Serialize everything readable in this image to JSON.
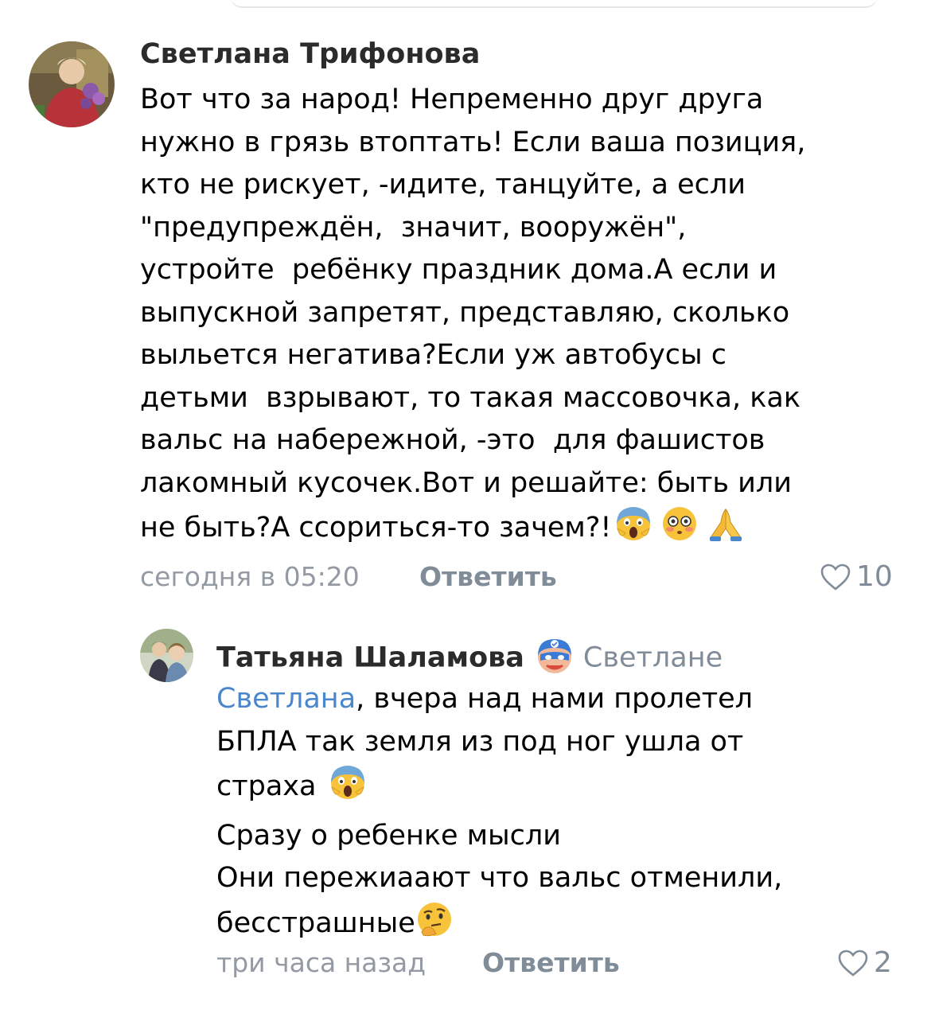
{
  "comments": [
    {
      "author": "Светлана Трифонова",
      "text_lines": [
        "Вот что за народ! Непременно друг друга",
        "нужно в грязь втоптать! Если ваша позиция,",
        "кто не рискует, -идите, танцуйте, а если",
        "\"предупреждён,  значит, вооружён\",",
        "устройте  ребёнку праздник дома.А если и",
        "выпускной запретят, представляю, сколько",
        "выльется негатива?Если уж автобусы с",
        "детьми  взрывают, то такая массовочка, как",
        "вальс на набережной, -это  для фашистов",
        "лакомный кусочек.Вот и решайте: быть или",
        "не быть?А ссориться-то зачем?!"
      ],
      "trailing_emojis": [
        "😱",
        "😳",
        "🙏"
      ],
      "time": "сегодня в 05:20",
      "reply_label": "Ответить",
      "likes": "10"
    },
    {
      "author": "Татьяна Шаламова",
      "reply_to": "Светлане",
      "mention": "Светлана",
      "text_lines": [
        ", вчера над нами пролетел",
        "БПЛА так земля из под ног ушла от",
        "страха ",
        "Сразу о ребенке мысли",
        "Они пережиаают что вальс отменили,",
        "бесстрашные"
      ],
      "emoji_after_line_3": "😱",
      "emoji_after_line_6": "🤔",
      "time": "три часа назад",
      "reply_label": "Ответить",
      "likes": "2"
    }
  ],
  "colors": {
    "author": "#2b2b2b",
    "meta": "#939aa3",
    "action": "#818c99",
    "mention": "#4a86cc"
  }
}
